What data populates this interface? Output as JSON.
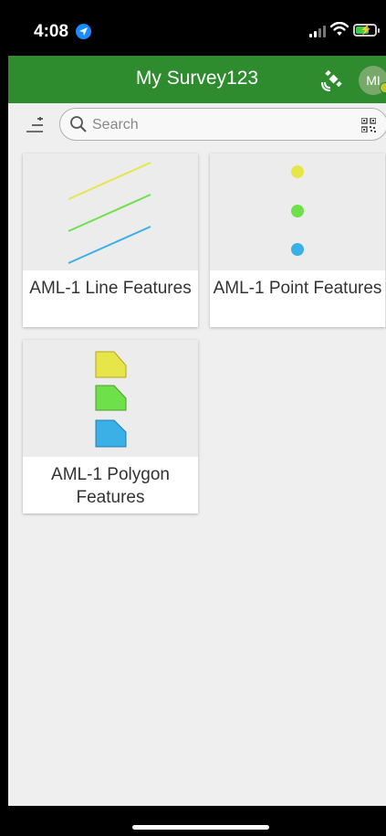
{
  "status_bar": {
    "time": "4:08"
  },
  "app_bar": {
    "title": "My Survey123",
    "avatar_initials": "MI"
  },
  "search": {
    "placeholder": "Search"
  },
  "surveys": [
    {
      "title": "AML-1 Line Features",
      "thumbnail": "three colored lines",
      "colors": [
        "#e6e64a",
        "#6ee04a",
        "#3ab0e6"
      ]
    },
    {
      "title": "AML-1 Point Features",
      "thumbnail": "three colored points",
      "colors": [
        "#e6e64a",
        "#6ee04a",
        "#3ab0e6"
      ]
    },
    {
      "title": "AML-1 Polygon Features",
      "thumbnail": "three colored polygons",
      "colors": [
        "#e6e64a",
        "#6ee04a",
        "#3ab0e6"
      ]
    }
  ],
  "colors": {
    "app_bar": "#2e8b2e",
    "background": "#efefef"
  }
}
